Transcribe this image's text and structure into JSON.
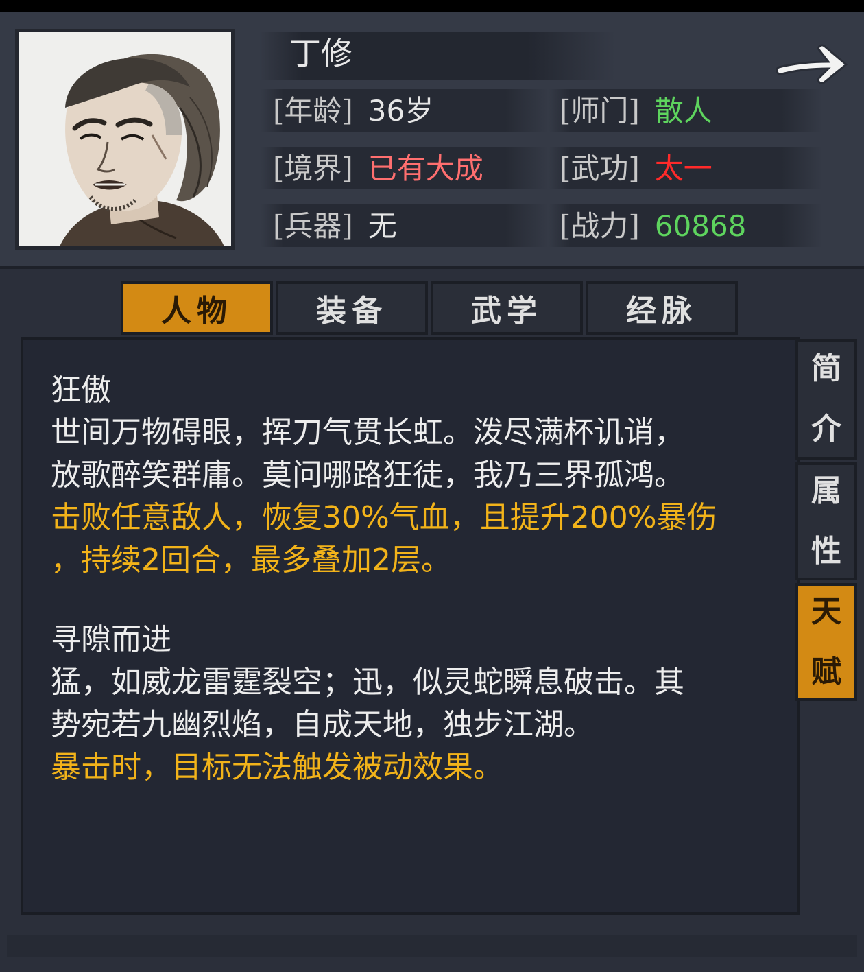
{
  "character": {
    "name": "丁修",
    "stats": [
      {
        "label": "[年龄]",
        "value": "36岁",
        "color": "#e6e6e6"
      },
      {
        "label": "[师门]",
        "value": "散人",
        "color": "#5ed45e"
      },
      {
        "label": "[境界]",
        "value": "已有大成",
        "color": "#ff6f6f"
      },
      {
        "label": "[武功]",
        "value": "太一",
        "color": "#ff2a2a"
      },
      {
        "label": "[兵器]",
        "value": "无",
        "color": "#e6e6e6"
      },
      {
        "label": "[战力]",
        "value": "60868",
        "color": "#5ed45e"
      }
    ]
  },
  "nav": {
    "next_icon": "right-arrow-icon"
  },
  "tabs": [
    {
      "label": "人物",
      "active": true
    },
    {
      "label": "装备",
      "active": false
    },
    {
      "label": "武学",
      "active": false
    },
    {
      "label": "经脉",
      "active": false
    }
  ],
  "side_tabs": [
    {
      "label": "简介",
      "active": false
    },
    {
      "label": "属性",
      "active": false
    },
    {
      "label": "天赋",
      "active": true
    }
  ],
  "talents": [
    {
      "title": "狂傲",
      "desc": [
        "世间万物碍眼，挥刀气贯长虹。泼尽满杯讥诮，",
        "放歌醉笑群庸。莫问哪路狂徒，我乃三界孤鸿。"
      ],
      "effect": [
        "击败任意敌人，恢复30%气血，且提升200%暴伤",
        "，持续2回合，最多叠加2层。"
      ]
    },
    {
      "title": "寻隙而进",
      "desc": [
        "猛，如威龙雷霆裂空；迅，似灵蛇瞬息破击。其",
        "势宛若九幽烈焰，自成天地，独步江湖。"
      ],
      "effect": [
        "暴击时，目标无法触发被动效果。"
      ]
    }
  ],
  "colors": {
    "accent": "#d38a14",
    "effect_text": "#f2b31a",
    "panel": "#232733"
  }
}
